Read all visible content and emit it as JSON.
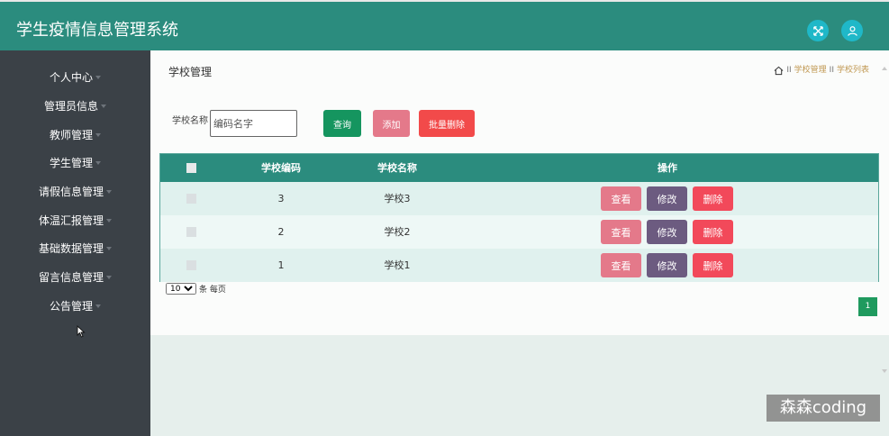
{
  "header": {
    "title": "学生疫情信息管理系统",
    "fullscreen_icon": "expand-icon",
    "user_icon": "user-icon"
  },
  "sidebar": {
    "items": [
      {
        "label": "个人中心"
      },
      {
        "label": "管理员信息"
      },
      {
        "label": "教师管理"
      },
      {
        "label": "学生管理"
      },
      {
        "label": "请假信息管理"
      },
      {
        "label": "体温汇报管理"
      },
      {
        "label": "基础数据管理"
      },
      {
        "label": "留言信息管理"
      },
      {
        "label": "公告管理"
      }
    ]
  },
  "main": {
    "page_title": "学校管理",
    "breadcrumb": [
      "学校管理",
      "学校列表"
    ],
    "breadcrumb_sep": "II",
    "search": {
      "label": "学校名称",
      "placeholder": "编码名字",
      "value": ""
    },
    "buttons": {
      "query": "查询",
      "add": "添加",
      "batch_delete": "批量删除"
    },
    "table": {
      "headers": [
        "学校编码",
        "学校名称",
        "操作"
      ],
      "rows": [
        {
          "code": "3",
          "name": "学校3"
        },
        {
          "code": "2",
          "name": "学校2"
        },
        {
          "code": "1",
          "name": "学校1"
        }
      ],
      "actions": {
        "view": "查看",
        "edit": "修改",
        "delete": "删除"
      }
    },
    "pagination": {
      "page_size": "10",
      "page_size_options": [
        "10"
      ],
      "page_size_suffix": "条 每页",
      "current_page": "1"
    }
  },
  "watermark": "森森coding",
  "colors": {
    "header": "#2b8c7e",
    "sidebar": "#3b4147",
    "query": "#15955f",
    "view": "#e4798a",
    "edit": "#6c5b80",
    "delete": "#f2495a"
  }
}
